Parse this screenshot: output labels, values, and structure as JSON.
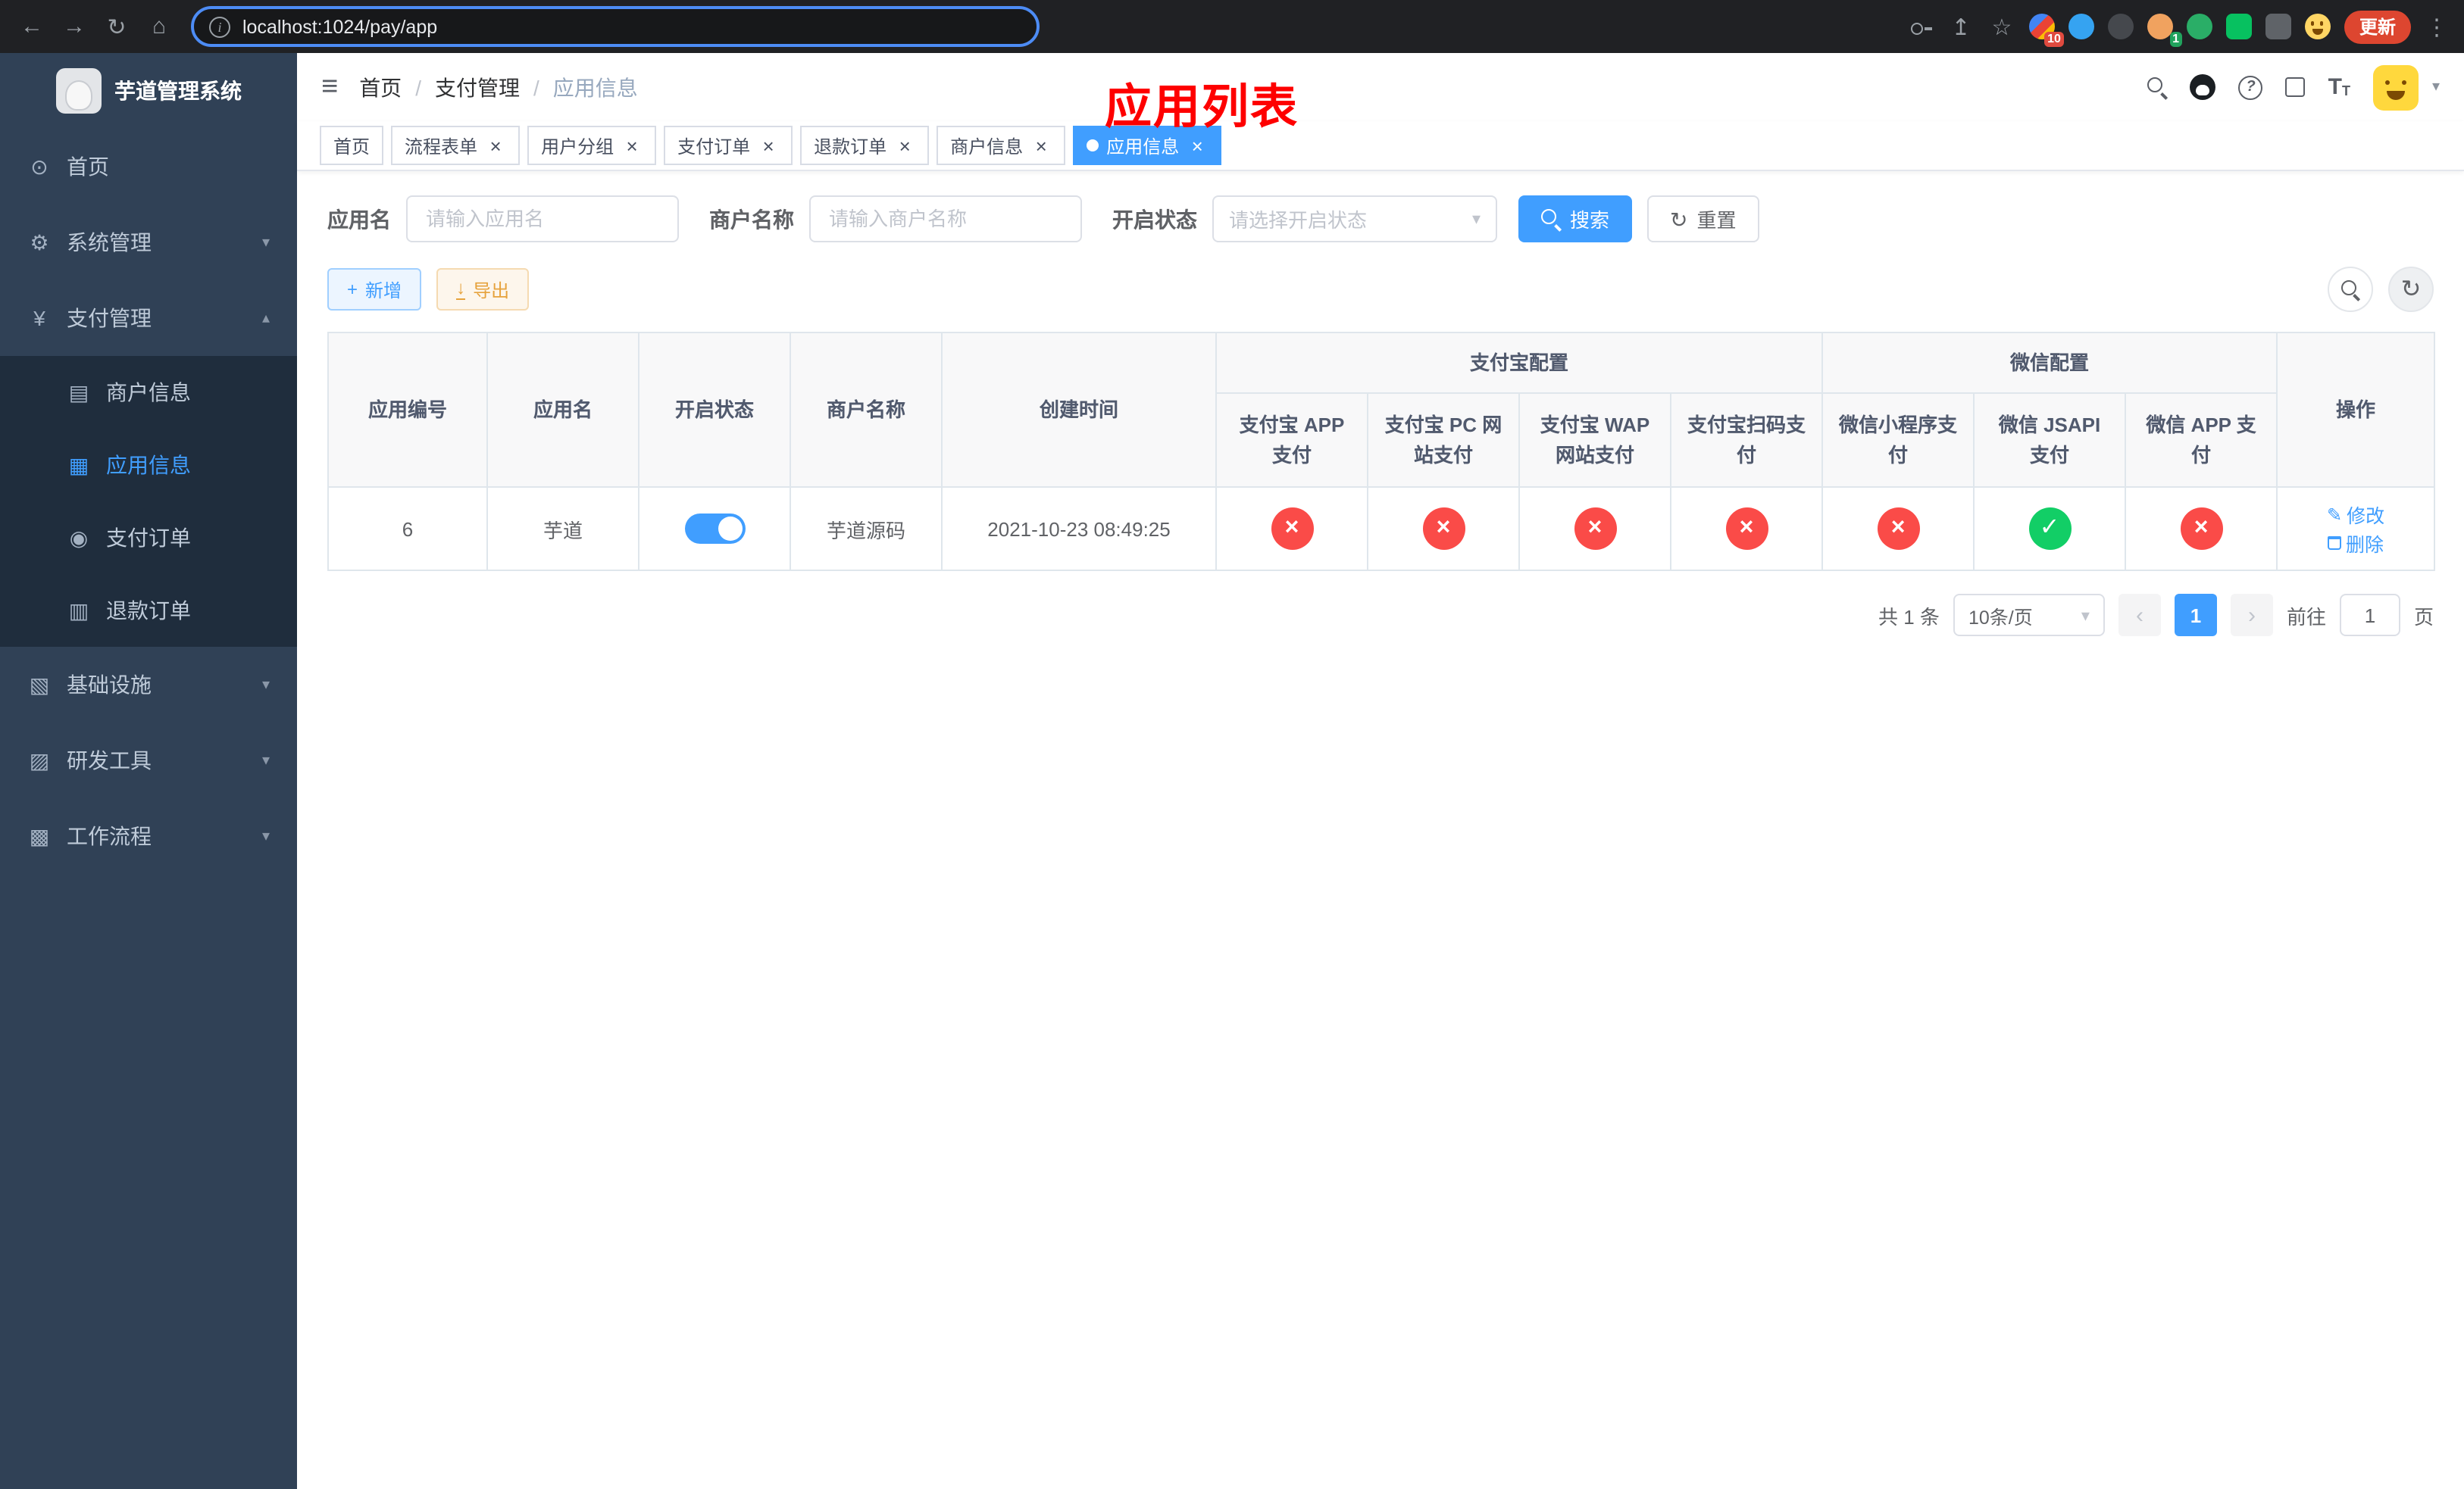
{
  "colors": {
    "accent": "#409eff",
    "danger": "#fa4b48",
    "success": "#12ce66",
    "annotation": "#fe0000",
    "sidebar_bg": "#304156",
    "sidebar_sub_bg": "#1f2d3d"
  },
  "icons": {
    "back": "←",
    "forward": "→",
    "reload": "↻",
    "home": "⌂",
    "share": "↥",
    "star": "☆",
    "overflow": "⋮",
    "hamburger": "≡",
    "slash": "/",
    "caret_down": "▾",
    "caret_up": "▴",
    "chevron_left": "‹",
    "chevron_right": "›",
    "dashboard": "⊙",
    "gear": "⚙",
    "yen": "¥",
    "merchant": "▤",
    "app": "▦",
    "order": "◉",
    "refund": "▥",
    "infra": "▧",
    "tools": "▨",
    "flow": "▩",
    "plus": "+",
    "download": "↓",
    "refresh": "↻",
    "check": "✓",
    "cross": "×",
    "edit": "✎",
    "help": "?",
    "font_large": "T",
    "font_small": "T",
    "info": "i"
  },
  "browser": {
    "url": "localhost:1024/pay/app",
    "update_label": "更新",
    "ext_badge_1": "10",
    "ext_badge_2": "1"
  },
  "sidebar": {
    "title": "芋道管理系统",
    "items": [
      {
        "label": "首页"
      },
      {
        "label": "系统管理"
      },
      {
        "label": "支付管理",
        "children": [
          {
            "label": "商户信息"
          },
          {
            "label": "应用信息"
          },
          {
            "label": "支付订单"
          },
          {
            "label": "退款订单"
          }
        ]
      },
      {
        "label": "基础设施"
      },
      {
        "label": "研发工具"
      },
      {
        "label": "工作流程"
      }
    ]
  },
  "navbar": {
    "breadcrumbs": [
      "首页",
      "支付管理",
      "应用信息"
    ],
    "annotation": "应用列表"
  },
  "tags": [
    {
      "label": "首页"
    },
    {
      "label": "流程表单"
    },
    {
      "label": "用户分组"
    },
    {
      "label": "支付订单"
    },
    {
      "label": "退款订单"
    },
    {
      "label": "商户信息"
    },
    {
      "label": "应用信息"
    }
  ],
  "filters": {
    "app_name_label": "应用名",
    "app_name_placeholder": "请输入应用名",
    "merchant_label": "商户名称",
    "merchant_placeholder": "请输入商户名称",
    "status_label": "开启状态",
    "status_placeholder": "请选择开启状态",
    "search_label": "搜索",
    "reset_label": "重置"
  },
  "toolbar": {
    "add_label": "新增",
    "export_label": "导出"
  },
  "table": {
    "headers": {
      "app_id": "应用编号",
      "app_name": "应用名",
      "status": "开启状态",
      "merchant": "商户名称",
      "created": "创建时间",
      "alipay_group": "支付宝配置",
      "wechat_group": "微信配置",
      "alipay_app": "支付宝 APP 支付",
      "alipay_pc": "支付宝 PC 网站支付",
      "alipay_wap": "支付宝 WAP 网站支付",
      "alipay_qr": "支付宝扫码支付",
      "wx_mini": "微信小程序支付",
      "wx_jsapi": "微信 JSAPI 支付",
      "wx_app": "微信 APP 支付",
      "actions": "操作"
    },
    "row": {
      "app_id": "6",
      "app_name": "芋道",
      "status_on": true,
      "merchant": "芋道源码",
      "created": "2021-10-23 08:49:25",
      "channels": [
        "cross",
        "cross",
        "cross",
        "cross",
        "cross",
        "check",
        "cross"
      ],
      "edit_label": "修改",
      "delete_label": "删除"
    }
  },
  "pagination": {
    "total_text": "共 1 条",
    "page_size": "10条/页",
    "current_page": "1",
    "goto_prefix": "前往",
    "goto_value": "1",
    "goto_suffix": "页"
  }
}
